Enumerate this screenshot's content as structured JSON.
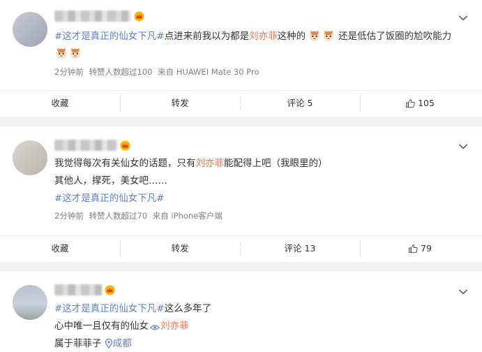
{
  "posts": [
    {
      "line1": {
        "topic": "#这才是真正的仙女下凡#",
        "text_a": "点进来前我以为都是",
        "name": "刘亦菲",
        "text_b": "这种的",
        "text_c": "还是低估了饭圈的尬吹能力"
      },
      "meta": {
        "time": "2分钟前",
        "reposts": "转赞人数超过100",
        "source": "来自 HUAWEI Mate 30 Pro"
      },
      "actions": {
        "fav": "收藏",
        "repost": "转发",
        "comment": "评论 5",
        "like": "105"
      }
    },
    {
      "line1": {
        "text_a": "我觉得每次有关仙女的话题，只有",
        "name": "刘亦菲",
        "text_b": "能配得上吧（我眼里的）"
      },
      "line2": "其他人，撑死，美女吧……",
      "line3": "#这才是真正的仙女下凡#",
      "meta": {
        "time": "2分钟前",
        "reposts": "转赞人数超过70",
        "source": "来自 iPhone客户端"
      },
      "actions": {
        "fav": "收藏",
        "repost": "转发",
        "comment": "评论 13",
        "like": "79"
      }
    },
    {
      "line1": {
        "topic": "#这才是真正的仙女下凡#",
        "text_a": "这么多年了"
      },
      "line2": {
        "text_a": "心中唯一且仅有的仙女",
        "name": "刘亦菲"
      },
      "line3": {
        "text_a": "属于菲菲子",
        "location": "成都"
      }
    }
  ],
  "icons": [
    "crown-icon",
    "chevron-down-icon",
    "cat-emoji-icon",
    "thumb-up-icon",
    "link-icon",
    "location-pin-icon"
  ],
  "colors": {
    "topic_blue": "#5d82c1",
    "name_orange": "#eb7350",
    "meta_gray": "#808080",
    "crown_gold": "#f5a623"
  }
}
